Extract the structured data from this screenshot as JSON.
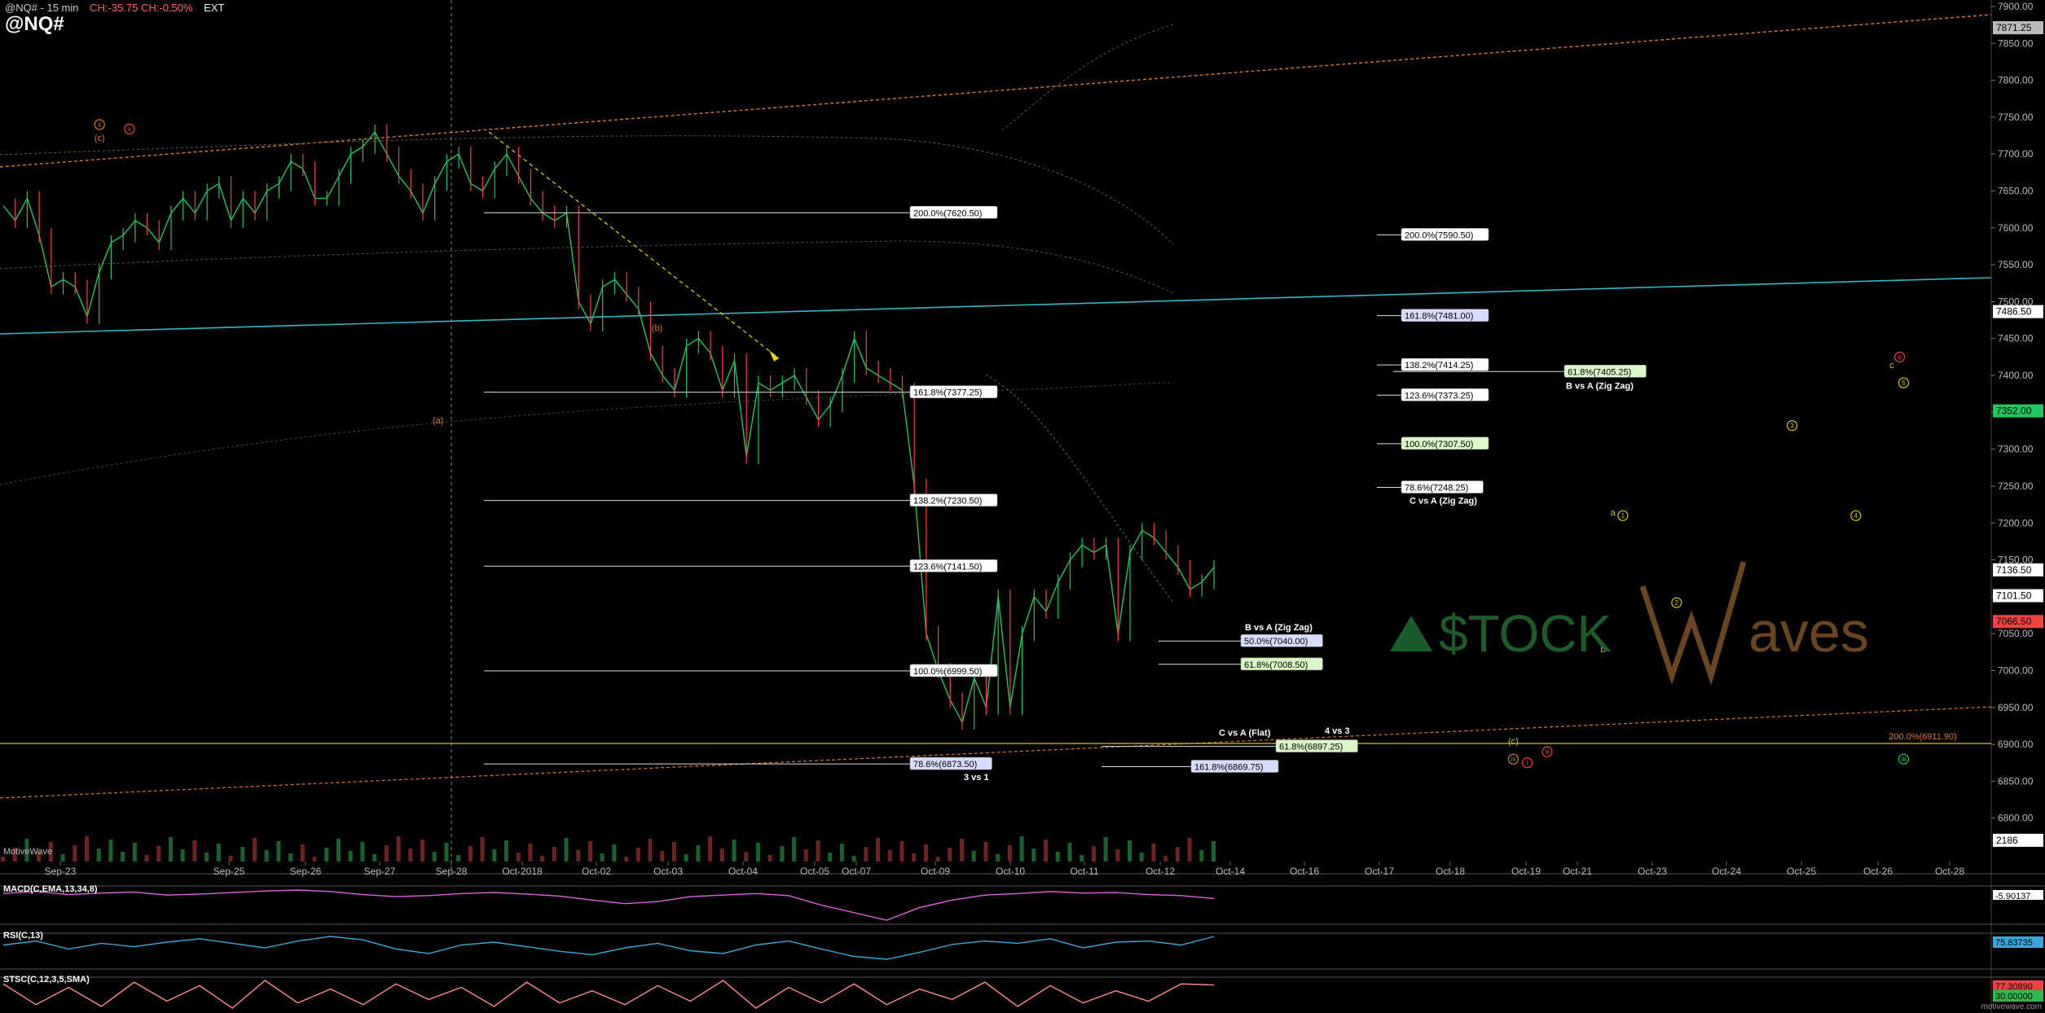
{
  "header": {
    "subtitle_symbol": "@NQ# - 15 min",
    "subtitle_change": "CH:-35.75  CH:-0.50%",
    "subtitle_ext": "EXT",
    "title": "@NQ#"
  },
  "brand": "MotiveWave",
  "footer": "motivewave.com",
  "watermark": {
    "part1": "$TOCK",
    "part2": "aves"
  },
  "colors": {
    "bull": "#22c55e",
    "bear": "#ef4444",
    "fib_label_bg": "#ffffff",
    "fib_green_bg": "#d9f7c8",
    "fib_blue_bg": "#d8dcff",
    "teal": "#2fb8c6",
    "orange": "#d9772d",
    "yellow": "#d4c21a",
    "macd": "#e060e0",
    "rsi": "#39a7d8",
    "stoch": "#ff8c8c"
  },
  "chart_data": [
    {
      "type": "line",
      "name": "price",
      "ylim": [
        6750,
        7900
      ],
      "yticks": [
        7900,
        7850,
        7800,
        7750,
        7700,
        7650,
        7600,
        7550,
        7500,
        7450,
        7400,
        7350,
        7300,
        7250,
        7200,
        7150,
        7100,
        7050,
        7000,
        6950,
        6900,
        6850,
        6800
      ],
      "ytick_labels": [
        "7900.00",
        "7850.00",
        "7800.00",
        "7750.00",
        "7700.00",
        "7650.00",
        "7600.00",
        "7550.00",
        "7500.00",
        "7450.00",
        "7400.00",
        "7350.00",
        "7300.00",
        "7250.00",
        "7200.00",
        "7150.00",
        "7100.00",
        "7050.00",
        "7000.00",
        "6950.00",
        "6900.00",
        "6850.00",
        "6800.00"
      ],
      "xticks": [
        "Sep-23",
        "Sep-25",
        "Sep-26",
        "Sep-27",
        "Sep-28",
        "Oct-2018",
        "Oct-02",
        "Oct-03",
        "Oct-04",
        "Oct-05",
        "Oct-07",
        "Oct-09",
        "Oct-10",
        "Oct-11",
        "Oct-12",
        "Oct-14",
        "Oct-16",
        "Oct-17",
        "Oct-18",
        "Oct-19",
        "Oct-21",
        "Oct-23",
        "Oct-24",
        "Oct-25",
        "Oct-26",
        "Oct-28"
      ],
      "series": [
        {
          "values": [
            7630,
            7610,
            7640,
            7590,
            7520,
            7530,
            7520,
            7480,
            7540,
            7580,
            7590,
            7610,
            7600,
            7580,
            7620,
            7640,
            7620,
            7650,
            7660,
            7610,
            7640,
            7620,
            7650,
            7660,
            7690,
            7680,
            7640,
            7640,
            7670,
            7700,
            7710,
            7730,
            7700,
            7670,
            7650,
            7620,
            7660,
            7690,
            7700,
            7660,
            7650,
            7680,
            7700,
            7670,
            7640,
            7620,
            7610,
            7620,
            7500,
            7470,
            7520,
            7530,
            7510,
            7490,
            7430,
            7400,
            7380,
            7440,
            7450,
            7430,
            7380,
            7420,
            7290,
            7390,
            7380,
            7390,
            7400,
            7370,
            7340,
            7360,
            7400,
            7450,
            7410,
            7400,
            7390,
            7380,
            7250,
            7050,
            7000,
            6960,
            6930,
            6990,
            6950,
            7100,
            6950,
            7050,
            7100,
            7080,
            7120,
            7150,
            7170,
            7160,
            7170,
            7050,
            7160,
            7190,
            7180,
            7160,
            7140,
            7110,
            7120,
            7140
          ]
        }
      ],
      "levels_left": [
        {
          "label": "200.0%(7620.50)",
          "value": 7620.5
        },
        {
          "label": "161.8%(7377.25)",
          "value": 7377.25
        },
        {
          "label": "138.2%(7230.50)",
          "value": 7230.5
        },
        {
          "label": "123.6%(7141.50)",
          "value": 7141.5
        },
        {
          "label": "100.0%(6999.50)",
          "value": 6999.5
        },
        {
          "label": "78.6%(6873.50)",
          "value": 6873.5,
          "style": "blue",
          "note": "3 vs 1"
        }
      ],
      "levels_mid": [
        {
          "label": "50.0%(7040.00)",
          "value": 7040.0,
          "style": "blue",
          "title": "B vs A (Zig Zag)"
        },
        {
          "label": "61.8%(7008.50)",
          "value": 7008.5,
          "style": "green"
        },
        {
          "label": "61.8%(6897.25)",
          "value": 6897.25,
          "style": "green",
          "title": "C vs A (Flat)"
        },
        {
          "label": "161.8%(6869.75)",
          "value": 6869.75,
          "style": "blue"
        }
      ],
      "levels_right": [
        {
          "label": "200.0%(7590.50)",
          "value": 7590.5
        },
        {
          "label": "161.8%(7481.00)",
          "value": 7481.0,
          "style": "blue"
        },
        {
          "label": "138.2%(7414.25)",
          "value": 7414.25
        },
        {
          "label": "123.6%(7373.25)",
          "value": 7373.25
        },
        {
          "label": "100.0%(7307.50)",
          "value": 7307.5,
          "style": "green"
        },
        {
          "label": "78.6%(7248.25)",
          "value": 7248.25,
          "note": "C vs A (Zig Zag)"
        }
      ],
      "level_far": {
        "label": "61.8%(7405.25)",
        "value": 7405.25,
        "style": "green",
        "note": "B vs A (Zig Zag)"
      },
      "line_4vs3": {
        "label": "4 vs 3",
        "value": 6912
      },
      "label_200_right": "200.0%(6911.90)",
      "price_markers": [
        {
          "label": "7871.25",
          "value": 7871.25,
          "color": "#bbbbbb"
        },
        {
          "label": "7486.50",
          "value": 7486.5,
          "color": "#ffffff"
        },
        {
          "label": "7352.00",
          "value": 7352.0,
          "color": "#22c55e"
        },
        {
          "label": "7136.50",
          "value": 7136.5,
          "color": "#ffffff"
        },
        {
          "label": "7101.50",
          "value": 7101.5,
          "color": "#ffffff"
        },
        {
          "label": "7066.50",
          "value": 7066.5,
          "color": "#ef4444"
        },
        {
          "label": "2186",
          "value": 6770,
          "color": "#ffffff"
        }
      ],
      "wave_labels": [
        {
          "t": "(c)",
          "x": 5.0,
          "y": 7718,
          "color": "#d9772d"
        },
        {
          "t": "(a)",
          "x": 22.0,
          "y": 7335,
          "color": "#d9772d"
        },
        {
          "t": "(b)",
          "x": 33.0,
          "y": 7460,
          "color": "#d9772d"
        },
        {
          "t": "a",
          "x": 81.0,
          "y": 7210,
          "color": "#d4c21a"
        },
        {
          "t": "b",
          "x": 80.5,
          "y": 7025,
          "color": "#d4c21a"
        },
        {
          "t": "c",
          "x": 95.0,
          "y": 7410,
          "color": "#d4c21a"
        },
        {
          "t": "(c)",
          "x": 76.0,
          "y": 6900,
          "color": "#d4c21a"
        }
      ],
      "circle_labels": [
        {
          "t": "ii",
          "x": 5.0,
          "y": 7740,
          "color": "#d9772d"
        },
        {
          "t": "ii",
          "x": 6.5,
          "y": 7734,
          "color": "#ef4444"
        },
        {
          "t": "1",
          "x": 81.5,
          "y": 7210,
          "color": "#d4c21a"
        },
        {
          "t": "2",
          "x": 84.2,
          "y": 7092,
          "color": "#d4c21a"
        },
        {
          "t": "3",
          "x": 90.0,
          "y": 7332,
          "color": "#d4c21a"
        },
        {
          "t": "4",
          "x": 93.2,
          "y": 7210,
          "color": "#d4c21a"
        },
        {
          "t": "5",
          "x": 95.6,
          "y": 7390,
          "color": "#d4c21a"
        },
        {
          "t": "ii",
          "x": 95.4,
          "y": 7425,
          "color": "#ef4444"
        },
        {
          "t": "iii",
          "x": 76.0,
          "y": 6880,
          "color": "#d9772d"
        },
        {
          "t": "iii",
          "x": 77.7,
          "y": 6890,
          "color": "#ef4444"
        },
        {
          "t": "i",
          "x": 76.7,
          "y": 6875,
          "color": "#ef4444"
        },
        {
          "t": "iii",
          "x": 95.6,
          "y": 6880,
          "color": "#22c55e"
        }
      ]
    },
    {
      "type": "line",
      "name": "MACD(C,EMA,13,34,8)",
      "label": "MACD(C,EMA,13,34,8)",
      "markers": [
        "-5.90137",
        "-50.0"
      ],
      "values": [
        8,
        12,
        6,
        9,
        11,
        5,
        7,
        10,
        13,
        15,
        12,
        6,
        2,
        4,
        8,
        10,
        7,
        3,
        -5,
        -12,
        -8,
        2,
        5,
        8,
        4,
        -15,
        -30,
        -45,
        -20,
        -5,
        5,
        8,
        12,
        9,
        10,
        6,
        4,
        -2
      ]
    },
    {
      "type": "line",
      "name": "RSI(C,13)",
      "label": "RSI(C,13)",
      "markers": [
        "75.83735"
      ],
      "values": [
        55,
        62,
        48,
        58,
        52,
        60,
        66,
        58,
        50,
        62,
        70,
        64,
        48,
        40,
        55,
        60,
        52,
        44,
        38,
        50,
        58,
        45,
        40,
        55,
        62,
        48,
        35,
        30,
        42,
        56,
        62,
        58,
        66,
        50,
        60,
        62,
        55,
        70
      ]
    },
    {
      "type": "line",
      "name": "STSC(C,12,3,5,SMA)",
      "label": "STSC(C,12,3,5,SMA)",
      "markers": [
        "77.30890",
        "30.00000"
      ],
      "values": [
        80,
        20,
        70,
        15,
        85,
        30,
        75,
        10,
        90,
        25,
        65,
        20,
        80,
        35,
        70,
        15,
        85,
        25,
        60,
        20,
        75,
        30,
        90,
        10,
        70,
        25,
        80,
        20,
        65,
        35,
        85,
        15,
        75,
        25,
        60,
        30,
        80,
        77
      ]
    }
  ]
}
